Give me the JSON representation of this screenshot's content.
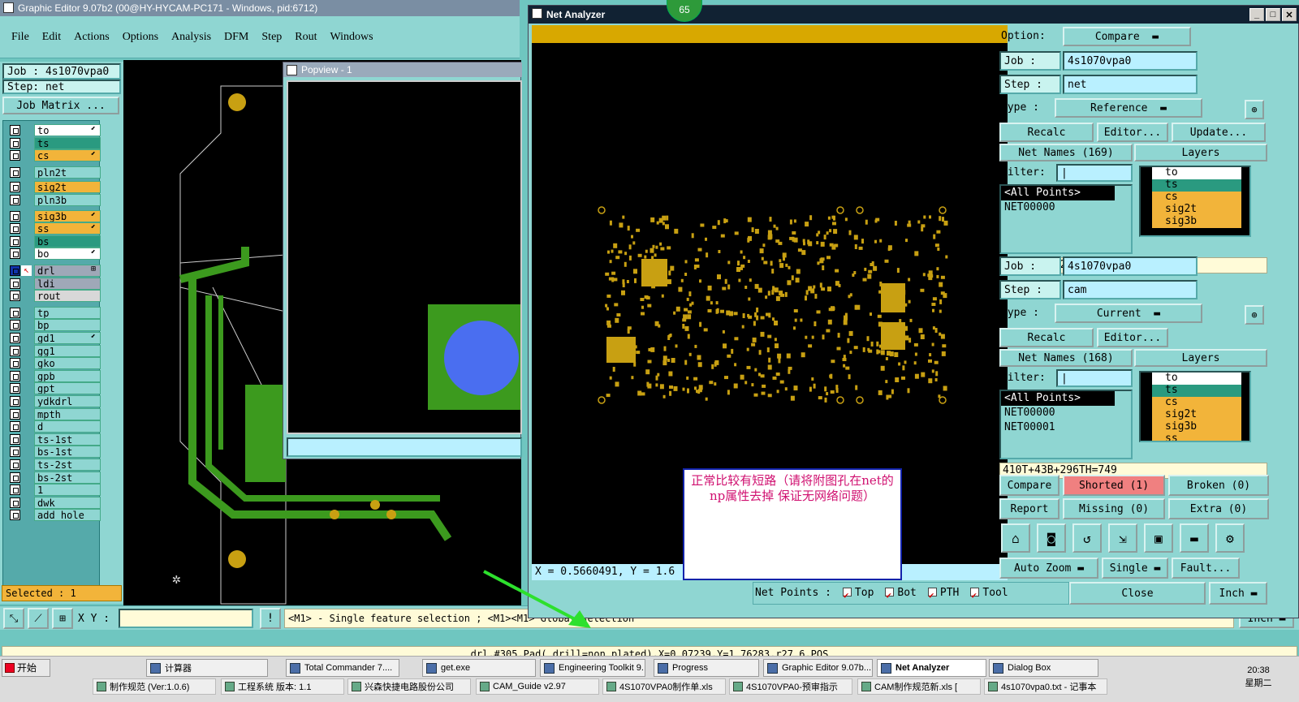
{
  "main_window": {
    "title": "Graphic Editor 9.07b2 (00@HY-HYCAM-PC171 - Windows, pid:6712)",
    "menu": [
      "File",
      "Edit",
      "Actions",
      "Options",
      "Analysis",
      "DFM",
      "Step",
      "Rout",
      "Windows"
    ],
    "job_label": "Job : 4s1070vpa0",
    "step_label": "Step: net",
    "job_matrix": "Job Matrix ...",
    "selected": "Selected : 1",
    "xy_label": "X Y :",
    "hint": "<M1> - Single feature selection ; <M1><M1> Global selection",
    "status": "drl,#305,Pad(.drill=non_plated),X=0.07239,Y=1.76283,r27.6,POS",
    "units": "Inch"
  },
  "layers": [
    {
      "name": "to",
      "color": "#ffffff",
      "mark": "⬋"
    },
    {
      "name": "ts",
      "color": "#2a9a80",
      "mark": ""
    },
    {
      "name": "cs",
      "color": "#f2b43a",
      "mark": "⬋"
    },
    {
      "name": "pln2t",
      "color": "#8fd6d2",
      "mark": ""
    },
    {
      "name": "sig2t",
      "color": "#f2b43a",
      "mark": ""
    },
    {
      "name": "pln3b",
      "color": "#8fd6d2",
      "mark": ""
    },
    {
      "name": "sig3b",
      "color": "#f2b43a",
      "mark": "⬋"
    },
    {
      "name": "ss",
      "color": "#f2b43a",
      "mark": "⬋"
    },
    {
      "name": "bs",
      "color": "#2a9a80",
      "mark": ""
    },
    {
      "name": "bo",
      "color": "#ffffff",
      "mark": "⬋"
    },
    {
      "name": "drl",
      "color": "#9fa8b8",
      "mark": "⊞"
    },
    {
      "name": "ldi",
      "color": "#9fa8b8",
      "mark": ""
    },
    {
      "name": "rout",
      "color": "#d8d8d8",
      "mark": ""
    },
    {
      "name": "tp",
      "color": "#8fd6d2",
      "mark": ""
    },
    {
      "name": "bp",
      "color": "#8fd6d2",
      "mark": ""
    },
    {
      "name": "gd1",
      "color": "#8fd6d2",
      "mark": "⬋"
    },
    {
      "name": "gg1",
      "color": "#8fd6d2",
      "mark": ""
    },
    {
      "name": "gko",
      "color": "#8fd6d2",
      "mark": ""
    },
    {
      "name": "gpb",
      "color": "#8fd6d2",
      "mark": ""
    },
    {
      "name": "gpt",
      "color": "#8fd6d2",
      "mark": ""
    },
    {
      "name": "ydkdrl",
      "color": "#8fd6d2",
      "mark": ""
    },
    {
      "name": "mpth",
      "color": "#8fd6d2",
      "mark": ""
    },
    {
      "name": "d",
      "color": "#8fd6d2",
      "mark": ""
    },
    {
      "name": "ts-1st",
      "color": "#8fd6d2",
      "mark": ""
    },
    {
      "name": "bs-1st",
      "color": "#8fd6d2",
      "mark": ""
    },
    {
      "name": "ts-2st",
      "color": "#8fd6d2",
      "mark": ""
    },
    {
      "name": "bs-2st",
      "color": "#8fd6d2",
      "mark": ""
    },
    {
      "name": "1",
      "color": "#8fd6d2",
      "mark": ""
    },
    {
      "name": "dwk",
      "color": "#8fd6d2",
      "mark": ""
    },
    {
      "name": "add_hole",
      "color": "#8fd6d2",
      "mark": ""
    }
  ],
  "popview": {
    "title": "Popview - 1"
  },
  "net_analyzer": {
    "title": "Net Analyzer",
    "badge": "65",
    "coords": "X = 0.5660491, Y = 1.6",
    "note": "正常比较有短路（请将附图孔在net的np属性去掉 保证无网络问题）",
    "option_label": "Option:",
    "option_value": "Compare",
    "ref": {
      "job_label": "Job   :",
      "job": "4s1070vpa0",
      "step_label": "Step  :",
      "step": "net",
      "type_label": "Type  :",
      "type": "Reference",
      "recalc": "Recalc",
      "editor": "Editor...",
      "update": "Update...",
      "net_names": "Net Names (169)",
      "layers_label": "Layers",
      "filter": "Filter:",
      "nets": [
        "<All Points>",
        "NET00000"
      ],
      "layers": [
        "to",
        "ts",
        "cs",
        "sig2t",
        "sig3b"
      ],
      "summary": "410T+43B+296TH=749"
    },
    "cur": {
      "job_label": "Job   :",
      "job": "4s1070vpa0",
      "step_label": "Step  :",
      "step": "cam",
      "type_label": "Type  :",
      "type": "Current",
      "recalc": "Recalc",
      "editor": "Editor...",
      "net_names": "Net Names (168)",
      "layers_label": "Layers",
      "filter": "Filter:",
      "nets": [
        "<All Points>",
        "NET00000",
        "NET00001"
      ],
      "layers": [
        "to",
        "ts",
        "cs",
        "sig2t",
        "sig3b",
        "ss"
      ],
      "summary": "410T+43B+296TH=749"
    },
    "compare": "Compare",
    "shorted": "Shorted (1)",
    "broken": "Broken (0)",
    "report": "Report",
    "missing": "Missing (0)",
    "extra": "Extra (0)",
    "auto_zoom": "Auto Zoom",
    "single": "Single",
    "fault": "Fault...",
    "net_points": "Net Points :",
    "top": "Top",
    "bot": "Bot",
    "pth": "PTH",
    "tool": "Tool",
    "close": "Close",
    "units": "Inch",
    "tool_icons": [
      "home-icon",
      "camera-icon",
      "loop-icon",
      "route-icon",
      "frame-icon",
      "ruler-icon",
      "gear-icon"
    ]
  },
  "taskbar": {
    "start": "开始",
    "items": [
      "计算器",
      "Total Commander 7....",
      "get.exe",
      "Engineering Toolkit 9...",
      "Progress",
      "Graphic Editor 9.07b...",
      "Net Analyzer",
      "Dialog Box"
    ],
    "items2": [
      "制作规范 (Ver:1.0.6)",
      "工程系统 版本: 1.1",
      "兴森快捷电路股份公司",
      "CAM_Guide v2.97",
      "4S1070VPA0制作单.xls",
      "4S1070VPA0-预审指示",
      "CAM制作规范新.xls [",
      "4s1070vpa0.txt - 记事本"
    ],
    "time": "20:38",
    "day": "星期二"
  },
  "colors": {
    "board_green": "#3c9a1e",
    "pad_gold": "#c8a012",
    "hole_blue": "#4a6ef0",
    "net_bar": "#d8a800",
    "shorted": "#f08080"
  }
}
